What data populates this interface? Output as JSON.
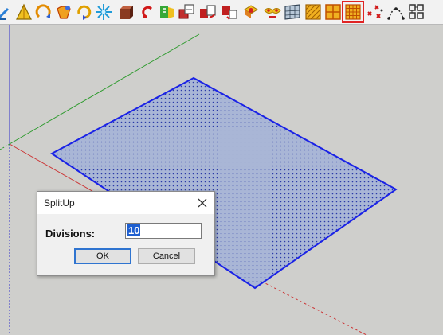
{
  "toolbar": {
    "icons": [
      "line-tool-icon",
      "triangle-tool-icon",
      "arc-rotate-icon",
      "face-curve-icon",
      "rotate-arrow-icon",
      "snowflake-icon",
      "box-extrude-icon",
      "hook-curve-icon",
      "flag-split-icon",
      "move-copy-icon",
      "rotate-copy-icon",
      "scale-copy-icon",
      "fill-face-icon",
      "eye-mask-icon",
      "panel-grid-icon",
      "pattern-fill-icon",
      "quad-grid-icon",
      "grid-split-icon",
      "scatter-points-icon",
      "curve-points-icon",
      "component-grid-icon"
    ],
    "selected_icon": "grid-split-icon"
  },
  "dialog": {
    "title": "SplitUp",
    "label": "Divisions:",
    "value": "10",
    "ok_label": "OK",
    "cancel_label": "Cancel"
  },
  "colors": {
    "face_fill": "#a9b6d6",
    "face_edge": "#1a22e6",
    "axis_green": "#2e9b2e",
    "axis_red": "#cc3333",
    "axis_blue": "#3333cc",
    "selected_outline": "#e02424"
  }
}
